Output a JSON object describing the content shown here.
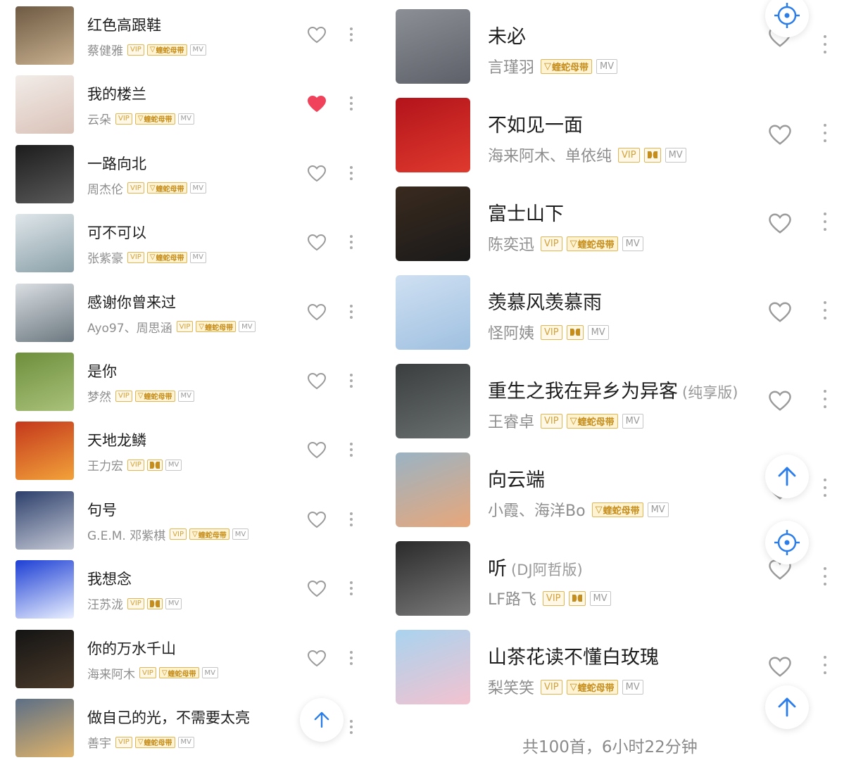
{
  "colors": {
    "accent": "#2b7de9",
    "liked": "#f0425a",
    "gold": "#d4a23c"
  },
  "left_list": [
    {
      "title": "红色高跟鞋",
      "suffix": "",
      "artist": "蔡健雅",
      "badges": [
        "VIP",
        "蝰蛇母带",
        "MV"
      ],
      "liked": false,
      "cover": [
        "#6e5a43",
        "#c8b08f"
      ]
    },
    {
      "title": "我的楼兰",
      "suffix": "",
      "artist": "云朵",
      "badges": [
        "VIP",
        "蝰蛇母带",
        "MV"
      ],
      "liked": true,
      "cover": [
        "#f2ece8",
        "#d9c2b8"
      ]
    },
    {
      "title": "一路向北",
      "suffix": "",
      "artist": "周杰伦",
      "badges": [
        "VIP",
        "蝰蛇母带",
        "MV"
      ],
      "liked": false,
      "cover": [
        "#1c1c1c",
        "#5a5a5a"
      ]
    },
    {
      "title": "可不可以",
      "suffix": "",
      "artist": "张紫豪",
      "badges": [
        "VIP",
        "蝰蛇母带",
        "MV"
      ],
      "liked": false,
      "cover": [
        "#dfe6ea",
        "#8aa0a8"
      ]
    },
    {
      "title": "感谢你曾来过",
      "suffix": "",
      "artist": "Ayo97、周思涵",
      "badges": [
        "VIP",
        "蝰蛇母带",
        "MV"
      ],
      "liked": false,
      "cover": [
        "#d9dee2",
        "#6c7880"
      ]
    },
    {
      "title": "是你",
      "suffix": "",
      "artist": "梦然",
      "badges": [
        "VIP",
        "蝰蛇母带",
        "MV"
      ],
      "liked": false,
      "cover": [
        "#6e8f3c",
        "#a9c27a"
      ]
    },
    {
      "title": "天地龙鳞",
      "suffix": "",
      "artist": "王力宏",
      "badges": [
        "VIP",
        "DOLBY",
        "MV"
      ],
      "liked": false,
      "cover": [
        "#c4381c",
        "#f2a23a"
      ]
    },
    {
      "title": "句号",
      "suffix": "",
      "artist": "G.E.M. 邓紫棋",
      "badges": [
        "VIP",
        "蝰蛇母带",
        "MV"
      ],
      "liked": false,
      "cover": [
        "#2c3f6b",
        "#c5c9d6"
      ]
    },
    {
      "title": "我想念",
      "suffix": "",
      "artist": "汪苏泷",
      "badges": [
        "VIP",
        "DOLBY",
        "MV"
      ],
      "liked": false,
      "cover": [
        "#1d3fd4",
        "#eaf0ff"
      ]
    },
    {
      "title": "你的万水千山",
      "suffix": "",
      "artist": "海来阿木",
      "badges": [
        "VIP",
        "蝰蛇母带",
        "MV"
      ],
      "liked": false,
      "cover": [
        "#141414",
        "#4a3a2a"
      ]
    },
    {
      "title": "做自己的光，不需要太亮",
      "suffix": "",
      "artist": "善宇",
      "badges": [
        "VIP",
        "蝰蛇母带",
        "MV"
      ],
      "liked": false,
      "cover": [
        "#5c6f86",
        "#e0b36a"
      ]
    }
  ],
  "right_list": [
    {
      "title": "未必",
      "suffix": "",
      "artist": "言瑾羽",
      "badges": [
        "蝰蛇母带",
        "MV"
      ],
      "liked": false,
      "cover": [
        "#8c8f96",
        "#5d6068"
      ]
    },
    {
      "title": "不如见一面",
      "suffix": "",
      "artist": "海来阿木、单依纯",
      "badges": [
        "VIP",
        "DOLBY",
        "MV"
      ],
      "liked": false,
      "cover": [
        "#b3141b",
        "#e03a2e"
      ]
    },
    {
      "title": "富士山下",
      "suffix": "",
      "artist": "陈奕迅",
      "badges": [
        "VIP",
        "蝰蛇母带",
        "MV"
      ],
      "liked": false,
      "cover": [
        "#3a2a1e",
        "#1a1a1a"
      ]
    },
    {
      "title": "羡慕风羡慕雨",
      "suffix": "",
      "artist": "怪阿姨",
      "badges": [
        "VIP",
        "DOLBY",
        "MV"
      ],
      "liked": false,
      "cover": [
        "#cfe0f2",
        "#9fc0e0"
      ]
    },
    {
      "title": "重生之我在异乡为异客",
      "suffix": "(纯享版)",
      "artist": "王睿卓",
      "badges": [
        "VIP",
        "蝰蛇母带",
        "MV"
      ],
      "liked": false,
      "cover": [
        "#3a3e3f",
        "#6a6f70"
      ]
    },
    {
      "title": "向云端",
      "suffix": "",
      "artist": "小霞、海洋Bo",
      "badges": [
        "蝰蛇母带",
        "MV"
      ],
      "liked": false,
      "cover": [
        "#9ab3c4",
        "#e8a77a"
      ]
    },
    {
      "title": "听",
      "suffix": "(DJ阿哲版)",
      "artist": "LF路飞",
      "badges": [
        "VIP",
        "DOLBY",
        "MV"
      ],
      "liked": false,
      "cover": [
        "#2a2a2a",
        "#7a7a7a"
      ]
    },
    {
      "title": "山茶花读不懂白玫瑰",
      "suffix": "",
      "artist": "梨笑笑",
      "badges": [
        "VIP",
        "蝰蛇母带",
        "MV"
      ],
      "liked": false,
      "cover": [
        "#a9d3ef",
        "#f3c2cf"
      ]
    }
  ],
  "footer": {
    "summary": "共100首，6小时22分钟"
  },
  "floating_buttons": [
    {
      "name": "locate-button",
      "icon": "crosshair-icon"
    },
    {
      "name": "scroll-top-button",
      "icon": "arrow-up-icon"
    }
  ]
}
